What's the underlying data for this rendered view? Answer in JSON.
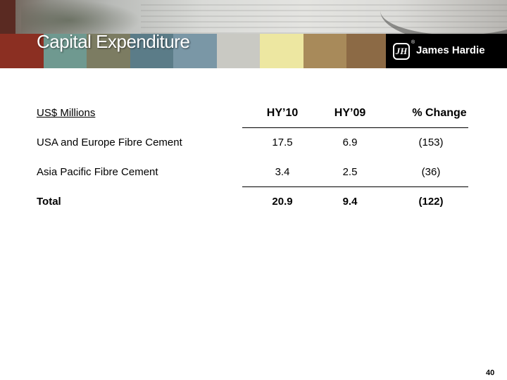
{
  "header": {
    "title": "Capital Expenditure",
    "logo_text": "James Hardie",
    "logo_mark": "JH",
    "logo_reg": "®",
    "swatch_colors": [
      "#8b2f22",
      "#6f9990",
      "#7c7c62",
      "#5b7c88",
      "#7a97a6",
      "#c9c9c3",
      "#ede7a1",
      "#a88a5a",
      "#8c6a45"
    ]
  },
  "table": {
    "columns": [
      "US$ Millions",
      "HY’10",
      "HY’09",
      "% Change"
    ],
    "rows": [
      {
        "label": "USA and Europe Fibre Cement",
        "hy10": "17.5",
        "hy09": "6.9",
        "change": "(153)"
      },
      {
        "label": "Asia Pacific Fibre Cement",
        "hy10": "3.4",
        "hy09": "2.5",
        "change": "(36)"
      },
      {
        "label": "Total",
        "hy10": "20.9",
        "hy09": "9.4",
        "change": "(122)"
      }
    ]
  },
  "footer": {
    "page_number": "40"
  }
}
